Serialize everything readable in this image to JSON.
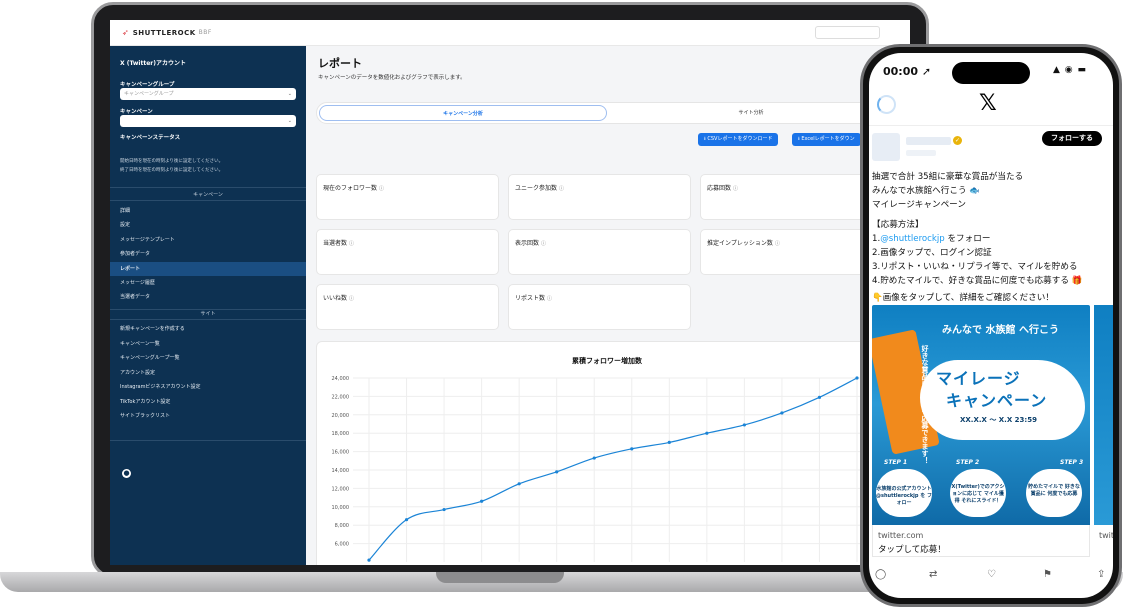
{
  "app": {
    "brand": "SHUTTLEROCK",
    "brand_sub": "BBF"
  },
  "sidebar": {
    "account": "X (Twitter)アカウント",
    "campaign_group_label": "キャンペーングループ",
    "campaign_group_placeholder": "キャンペーングループ",
    "campaign_label": "キャンペーン",
    "campaign_status_label": "キャンペーンステータス",
    "notes": [
      "開始日時を現在の時刻より後に設定してください。",
      "終了日時を現在の時刻より後に設定してください。"
    ],
    "section_campaign": "キャンペーン",
    "campaign_items": [
      "詳細",
      "設定",
      "メッセージテンプレート",
      "参加者データ",
      "レポート",
      "メッセージ履歴",
      "当選者データ"
    ],
    "active_item": "レポート",
    "section_site": "サイト",
    "site_items": [
      "新規キャンペーンを作成する",
      "キャンペーン一覧",
      "キャンペーングループ一覧",
      "アカウント設定",
      "Instagramビジネスアカウント設定",
      "TikTokアカウント設定",
      "サイトブラックリスト"
    ]
  },
  "main": {
    "title": "レポート",
    "description": "キャンペーンのデータを数値化およびグラフで表示します。",
    "tabs": [
      "キャンペーン分析",
      "サイト分析"
    ],
    "csv_button": "CSVレポートをダウンロード",
    "excel_button": "Excelレポートをダウン",
    "metrics": [
      "現在のフォロワー数",
      "ユニーク参加数",
      "応募回数",
      "当選者数",
      "表示回数",
      "推定インプレッション数",
      "いいね数",
      "リポスト数"
    ],
    "info_glyph": "ⓘ"
  },
  "chart_data": {
    "type": "line",
    "title": "累積フォロワー増加数",
    "xlabel": "",
    "ylabel": "",
    "ylim": [
      4000,
      24000
    ],
    "yticks": [
      "6,000",
      "8,000",
      "10,000",
      "12,000",
      "14,000",
      "16,000",
      "18,000",
      "20,000",
      "22,000",
      "24,000"
    ],
    "ytick_values": [
      6000,
      8000,
      10000,
      12000,
      14000,
      16000,
      18000,
      20000,
      22000,
      24000
    ],
    "grid": true,
    "series": [
      {
        "color": "#1b84d6",
        "values": [
          4200,
          8600,
          9700,
          10600,
          12500,
          13800,
          15300,
          16300,
          17000,
          18000,
          18900,
          20200,
          21900,
          24000
        ]
      }
    ]
  },
  "phone": {
    "time": "00:00",
    "status_icons": "▲ ◉ ▬",
    "follow_button": "フォローする",
    "tweet_lines": [
      "抽選で合計 35組に豪華な賞品が当たる",
      "みんなで水族館へ行こう 🐟",
      "マイレージキャンペーン",
      "",
      "【応募方法】",
      "1.@shuttlerockjp をフォロー",
      "2.画像タップで、ログイン認証",
      "3.リポスト・いいね・リプライ等で、マイルを貯める",
      "4.貯めたマイルで、好きな賞品に何度でも応募する 🎁",
      "",
      "👇画像をタップして、詳細をご確認ください！"
    ],
    "mention": "@shuttlerockjp",
    "promo": {
      "header": "みんなで 水族館 へ行こう",
      "badge": "好きな賞品に何度でも応募できます！",
      "title_line1": "マイレージ",
      "title_line2": "キャンペーン",
      "date": "XX.X.X ～ X.X 23:59",
      "steps": [
        {
          "label": "STEP 1",
          "text": "水族館の公式アカウント @shuttlerockjp を フォロー"
        },
        {
          "label": "STEP 2",
          "text": "X(Twitter)でのアクションに応じて マイル獲得 それにスライド！"
        },
        {
          "label": "STEP 3",
          "text": "貯めたマイルで 好きな賞品に 何度でも応募"
        }
      ]
    },
    "card_url": "twitter.com",
    "card_cta": "タップして応募！",
    "card_url_2": "twitt",
    "actions": [
      "reply",
      "repost",
      "like",
      "bookmark",
      "share"
    ]
  }
}
